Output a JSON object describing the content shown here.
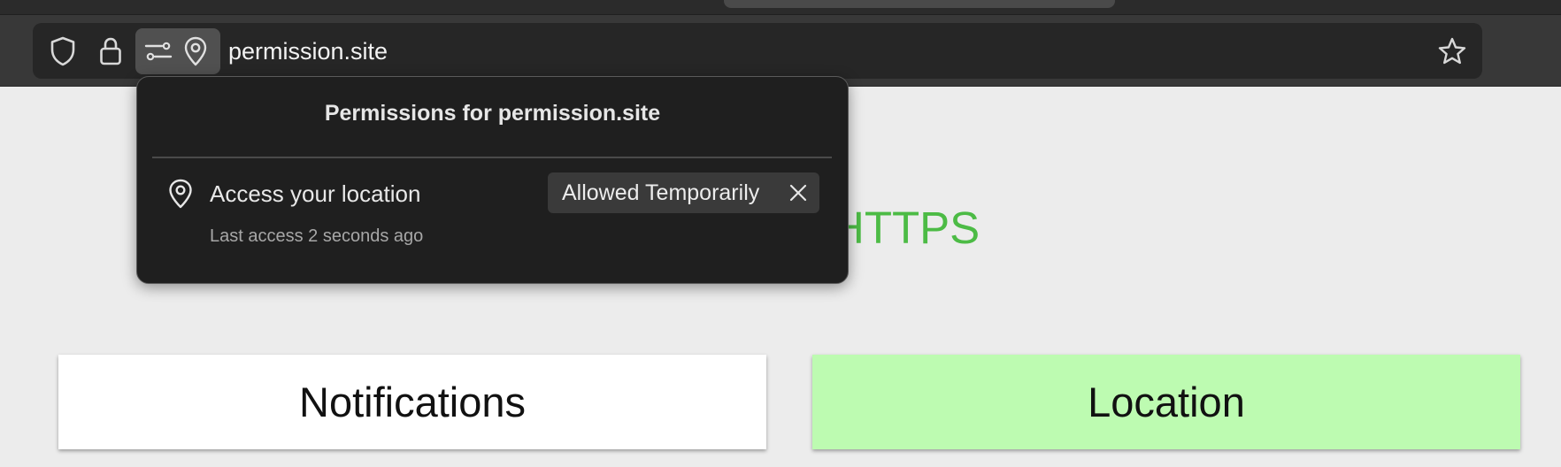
{
  "browser": {
    "url": "permission.site",
    "icons": {
      "tracking_protection": "shield-icon",
      "connection": "lock-icon",
      "permissions": "sliders-icon",
      "location_permission": "location-pin-icon",
      "bookmark": "star-icon"
    }
  },
  "popup": {
    "title": "Permissions for permission.site",
    "permission": {
      "icon": "location-pin-icon",
      "label": "Access your location",
      "last_access": "Last access 2 seconds ago",
      "state": "Allowed Temporarily",
      "clear_icon": "close-icon"
    }
  },
  "page": {
    "partial_heading": "HTTPS",
    "buttons": {
      "notifications": "Notifications",
      "location": "Location"
    }
  },
  "colors": {
    "https_heading": "#4cbb45",
    "location_button_bg": "#bdfbb1",
    "notifications_button_bg": "#ffffff",
    "popup_bg": "#1f1f1f"
  }
}
